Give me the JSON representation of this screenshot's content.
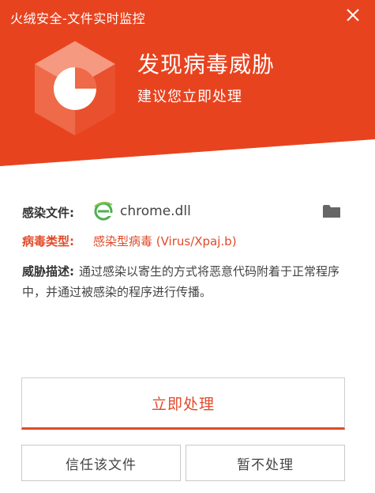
{
  "window": {
    "title": "火绒安全-文件实时监控",
    "close_icon": "close-icon"
  },
  "alert": {
    "title": "发现病毒威胁",
    "subtitle": "建议您立即处理"
  },
  "details": {
    "file_label": "感染文件:",
    "file_name": "chrome.dll",
    "file_icon": "ie-browser-icon",
    "folder_icon": "folder-icon",
    "type_label": "病毒类型:",
    "type_value": "感染型病毒 (Virus/Xpaj.b)",
    "desc_label": "威胁描述:",
    "desc_text": "通过感染以寄生的方式将恶意代码附着于正常程序中，并通过被感染的程序进行传播。"
  },
  "actions": {
    "primary_label": "立即处理",
    "trust_label": "信任该文件",
    "ignore_label": "暂不处理"
  },
  "colors": {
    "accent": "#e8431f",
    "accent_text": "#e04a2a"
  }
}
